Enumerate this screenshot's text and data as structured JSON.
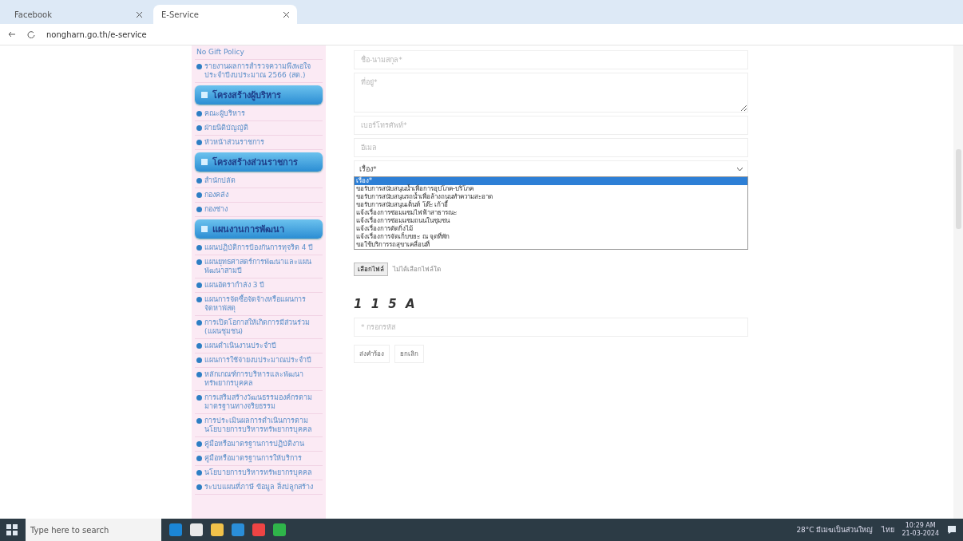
{
  "browser": {
    "tabs": [
      {
        "title": "Facebook",
        "selected": false
      },
      {
        "title": "E-Service",
        "selected": true
      }
    ],
    "url": "nongharn.go.th/e-service"
  },
  "sidebar": {
    "items": [
      {
        "kind": "plain",
        "label": "No Gift Policy"
      },
      {
        "kind": "link",
        "label": "รายงานผลการสำรวจความพึงพอใจ ประจำปีงบประมาณ 2566 (สต.)"
      },
      {
        "kind": "heading",
        "label": "โครงสร้างผู้บริหาร"
      },
      {
        "kind": "link",
        "label": "คณะผู้บริหาร"
      },
      {
        "kind": "link",
        "label": "ฝ่ายนิติบัญญัติ"
      },
      {
        "kind": "link",
        "label": "หัวหน้าส่วนราชการ"
      },
      {
        "kind": "heading",
        "label": "โครงสร้างส่วนราชการ"
      },
      {
        "kind": "link",
        "label": "สำนักปลัด"
      },
      {
        "kind": "link",
        "label": "กองคลัง"
      },
      {
        "kind": "link",
        "label": "กองช่าง"
      },
      {
        "kind": "heading",
        "label": "แผนงานการพัฒนา"
      },
      {
        "kind": "link",
        "label": "แผนปฏิบัติการป้องกันการทุจริต 4 ปี"
      },
      {
        "kind": "link",
        "label": "แผนยุทธศาสตร์การพัฒนาและแผนพัฒนาสามปี"
      },
      {
        "kind": "link",
        "label": "แผนอัตรากำลัง 3 ปี"
      },
      {
        "kind": "link",
        "label": "แผนการจัดซื้อจัดจ้างหรือแผนการจัดหาพัสดุ"
      },
      {
        "kind": "link",
        "label": "การเปิดโอกาสให้เกิดการมีส่วนร่วม (แผนชุมชน)"
      },
      {
        "kind": "link",
        "label": "แผนดำเนินงานประจำปี"
      },
      {
        "kind": "link",
        "label": "แผนการใช้จ่ายงบประมาณประจำปี"
      },
      {
        "kind": "link",
        "label": "หลักเกณฑ์การบริหารและพัฒนาทรัพยากรบุคคล"
      },
      {
        "kind": "link",
        "label": "การเสริมสร้างวัฒนธรรมองค์กรตามมาตรฐานทางจริยธรรม"
      },
      {
        "kind": "link",
        "label": "การประเมินผลการดำเนินการตามนโยบายการบริหารทรัพยากรบุคคล"
      },
      {
        "kind": "link",
        "label": "คู่มือหรือมาตรฐานการปฏิบัติงาน"
      },
      {
        "kind": "link",
        "label": "คู่มือหรือมาตรฐานการให้บริการ"
      },
      {
        "kind": "link",
        "label": "นโยบายการบริหารทรัพยากรบุคคล"
      },
      {
        "kind": "link",
        "label": "ระบบแผนที่ภาษี ข้อมูล สิ่งปลูกสร้าง"
      }
    ]
  },
  "form": {
    "fields": [
      {
        "kind": "input",
        "placeholder": "ชื่อ-นามสกุล*"
      },
      {
        "kind": "textarea",
        "placeholder": "ที่อยู่*"
      },
      {
        "kind": "input",
        "placeholder": "เบอร์โทรศัพท์*"
      },
      {
        "kind": "input",
        "placeholder": "อีเมล"
      }
    ],
    "subject": {
      "value": "เรื่อง*",
      "expanded": true,
      "options": [
        {
          "label": "เรื่อง*",
          "selected": true
        },
        {
          "label": "ขอรับการสนับสนุนน้ำเพื่อการอุปโภค-บริโภค",
          "selected": false
        },
        {
          "label": "ขอรับการสนับสนุนรถน้ำเพื่อล้างถนนทำความสะอาด",
          "selected": false
        },
        {
          "label": "ขอรับการสนับสนุนเต็นท์ โต๊ะ เก้าอี้",
          "selected": false
        },
        {
          "label": "แจ้งเรื่องการซ่อมแซมไฟฟ้าสาธารณะ",
          "selected": false
        },
        {
          "label": "แจ้งเรื่องการซ่อมแซมถนนในชุมชน",
          "selected": false
        },
        {
          "label": "แจ้งเรื่องการตัดกิ่งไม้",
          "selected": false
        },
        {
          "label": "แจ้งเรื่องการจัดเก็บขยะ ณ จุดที่พัก",
          "selected": false
        },
        {
          "label": "ขอใช้บริการรถสุขาเคลื่อนที่",
          "selected": false
        }
      ]
    },
    "file": {
      "button": "เลือกไฟล์",
      "status": "ไม่ได้เลือกไฟล์ใด"
    },
    "captcha": "1 1 5 A",
    "code_field": {
      "placeholder": "* กรอกรหัส"
    },
    "buttons": [
      "ส่งคำร้อง",
      "ยกเลิก"
    ]
  },
  "taskbar": {
    "search": "Type here to search",
    "weather": "28°C มีเมฆเป็นส่วนใหญ่",
    "language": "ไทย",
    "time": "10:29 AM",
    "date": "21-03-2024"
  }
}
